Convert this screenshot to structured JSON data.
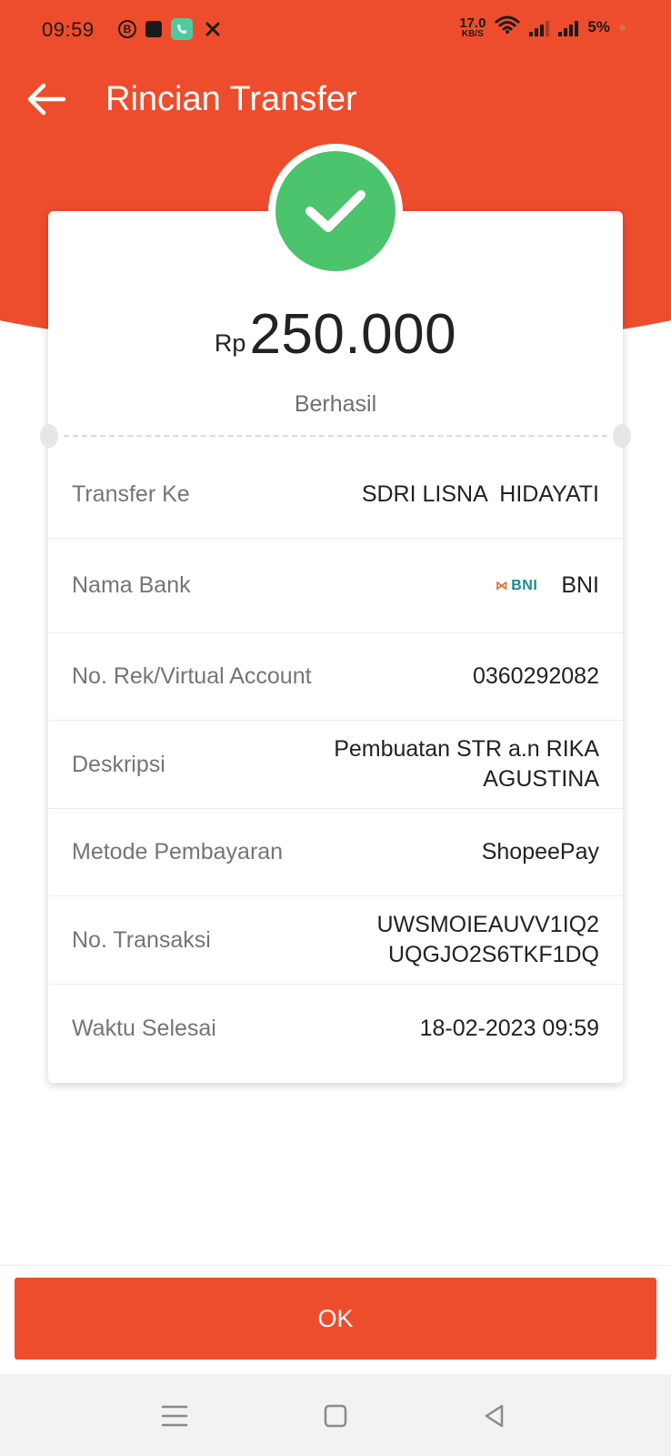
{
  "status_bar": {
    "time": "09:59",
    "net_speed_value": "17.0",
    "net_speed_unit": "KB/S",
    "battery": "5%",
    "icons": [
      "b-circle-icon",
      "shopping-bag-icon",
      "whatsapp-icon",
      "x-icon",
      "wifi-icon",
      "signal-icon",
      "signal-icon"
    ]
  },
  "header": {
    "title": "Rincian Transfer",
    "color": "#EE4D2D"
  },
  "summary": {
    "currency": "Rp",
    "amount": "250.000",
    "status": "Berhasil",
    "status_icon": "check-icon",
    "status_color": "#4CC36D"
  },
  "details": {
    "transfer_to": {
      "label": "Transfer Ke",
      "value": "SDRI LISNA  HIDAYATI"
    },
    "bank": {
      "label": "Nama Bank",
      "logo_text": "BNI",
      "value": "BNI"
    },
    "account": {
      "label": "No. Rek/Virtual Account",
      "value": "0360292082"
    },
    "description": {
      "label": "Deskripsi",
      "value_line1": "Pembuatan STR a.n RIKA",
      "value_line2": "AGUSTINA"
    },
    "payment_method": {
      "label": "Metode Pembayaran",
      "value": "ShopeePay"
    },
    "transaction_no": {
      "label": "No. Transaksi",
      "value_line1": "UWSMOIEAUVV1IQ2",
      "value_line2": "UQGJO2S6TKF1DQ"
    },
    "completed_time": {
      "label": "Waktu Selesai",
      "value": "18-02-2023 09:59"
    }
  },
  "actions": {
    "ok_label": "OK"
  },
  "nav": {
    "icons": [
      "menu-icon",
      "home-square-icon",
      "back-triangle-icon"
    ]
  }
}
